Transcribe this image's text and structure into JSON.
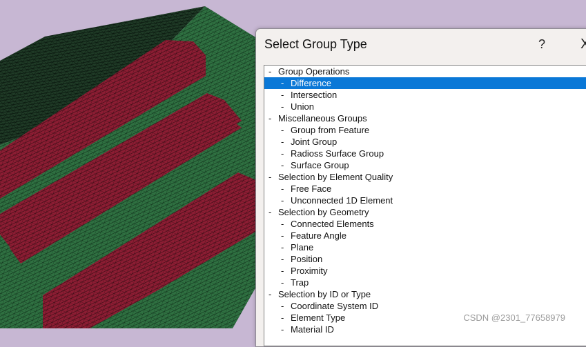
{
  "dialog": {
    "title": "Select Group Type",
    "help_label": "?",
    "close_label": "X"
  },
  "tree": [
    {
      "label": "Group Operations",
      "level": 0
    },
    {
      "label": "Difference",
      "level": 1,
      "selected": true
    },
    {
      "label": "Intersection",
      "level": 1
    },
    {
      "label": "Union",
      "level": 1
    },
    {
      "label": "Miscellaneous Groups",
      "level": 0
    },
    {
      "label": "Group from Feature",
      "level": 1
    },
    {
      "label": "Joint Group",
      "level": 1
    },
    {
      "label": "Radioss Surface Group",
      "level": 1
    },
    {
      "label": "Surface Group",
      "level": 1
    },
    {
      "label": "Selection by Element Quality",
      "level": 0
    },
    {
      "label": "Free Face",
      "level": 1
    },
    {
      "label": "Unconnected 1D Element",
      "level": 1
    },
    {
      "label": "Selection by Geometry",
      "level": 0
    },
    {
      "label": "Connected Elements",
      "level": 1
    },
    {
      "label": "Feature Angle",
      "level": 1
    },
    {
      "label": "Plane",
      "level": 1
    },
    {
      "label": "Position",
      "level": 1
    },
    {
      "label": "Proximity",
      "level": 1
    },
    {
      "label": "Trap",
      "level": 1
    },
    {
      "label": "Selection by ID or Type",
      "level": 0
    },
    {
      "label": "Coordinate System ID",
      "level": 1
    },
    {
      "label": "Element Type",
      "level": 1
    },
    {
      "label": "Material ID",
      "level": 1
    }
  ],
  "watermark": "CSDN @2301_77658979",
  "colors": {
    "background": "#c7b7d3",
    "mesh_green": "#2f7041",
    "mesh_red": "#8c1d33",
    "mesh_dark": "#0f2016",
    "selection": "#0a78d7"
  }
}
